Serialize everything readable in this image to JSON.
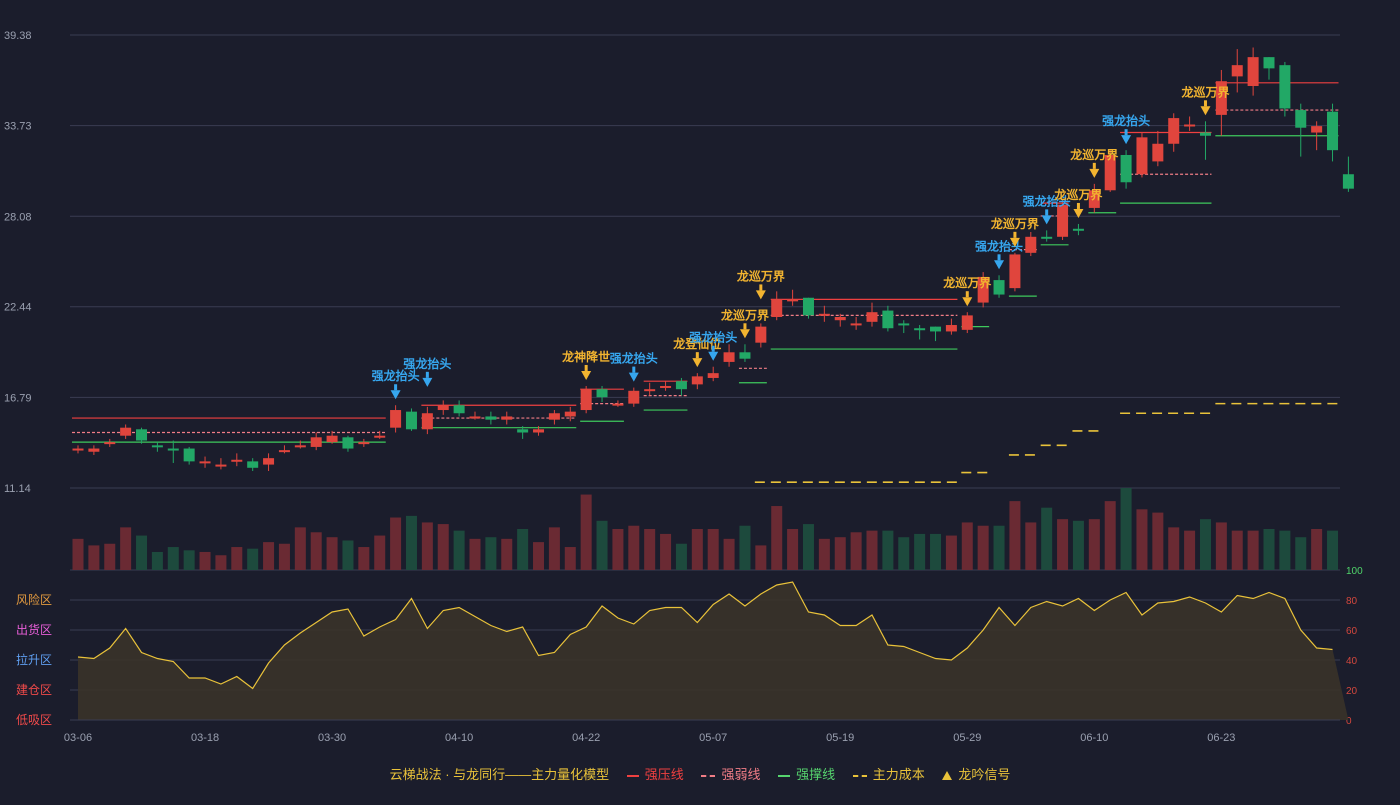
{
  "colors": {
    "background": "#1b1d2c",
    "up": "#e0453d",
    "down": "#22a866",
    "vol_up": "#6a2a33",
    "vol_down": "#1d4a3d",
    "strong_press": "#ef4040",
    "strong_weak": "#f07d86",
    "support": "#3ec95c",
    "cost": "#e9c23a",
    "signal_gold": "#f2b430",
    "signal_blue": "#36a6ee",
    "risk_line": "#e9c23a",
    "grid": "#3a3d52",
    "axis_text": "#9aa0b0"
  },
  "chart_data": {
    "type": "candlestick",
    "y_ticks": [
      "39.38",
      "33.73",
      "28.08",
      "22.44",
      "16.79",
      "11.14"
    ],
    "ylim": [
      11.14,
      39.38
    ],
    "x_ticks": [
      {
        "i": 0,
        "label": "03-06"
      },
      {
        "i": 8,
        "label": "03-18"
      },
      {
        "i": 16,
        "label": "03-30"
      },
      {
        "i": 24,
        "label": "04-10"
      },
      {
        "i": 32,
        "label": "04-22"
      },
      {
        "i": 40,
        "label": "05-07"
      },
      {
        "i": 48,
        "label": "05-19"
      },
      {
        "i": 56,
        "label": "05-29"
      },
      {
        "i": 64,
        "label": "06-10"
      },
      {
        "i": 72,
        "label": "06-23"
      }
    ],
    "candles": [
      [
        13.5,
        13.6,
        13.8,
        13.3
      ],
      [
        13.4,
        13.6,
        13.8,
        13.2
      ],
      [
        13.9,
        14.0,
        14.2,
        13.7
      ],
      [
        14.4,
        14.9,
        15.1,
        14.2
      ],
      [
        14.8,
        14.1,
        14.9,
        13.9
      ],
      [
        13.8,
        13.7,
        14.0,
        13.4
      ],
      [
        13.6,
        13.5,
        14.1,
        12.7
      ],
      [
        13.6,
        12.8,
        13.7,
        12.6
      ],
      [
        12.7,
        12.8,
        13.1,
        12.4
      ],
      [
        12.5,
        12.6,
        13.0,
        12.3
      ],
      [
        12.8,
        12.9,
        13.3,
        12.5
      ],
      [
        12.8,
        12.4,
        13.0,
        12.2
      ],
      [
        12.6,
        13.0,
        13.3,
        12.2
      ],
      [
        13.4,
        13.5,
        13.8,
        13.3
      ],
      [
        13.7,
        13.8,
        14.1,
        13.6
      ],
      [
        13.7,
        14.3,
        14.6,
        13.5
      ],
      [
        14.0,
        14.4,
        14.7,
        13.9
      ],
      [
        14.3,
        13.6,
        14.4,
        13.4
      ],
      [
        13.9,
        14.0,
        14.2,
        13.7
      ],
      [
        14.3,
        14.4,
        14.7,
        14.2
      ],
      [
        14.9,
        16.0,
        16.3,
        14.6
      ],
      [
        15.9,
        14.8,
        16.1,
        14.7
      ],
      [
        14.8,
        15.8,
        16.2,
        14.5
      ],
      [
        16.0,
        16.3,
        16.6,
        15.7
      ],
      [
        16.3,
        15.8,
        16.6,
        15.6
      ],
      [
        15.6,
        15.6,
        15.9,
        15.4
      ],
      [
        15.6,
        15.4,
        15.9,
        15.1
      ],
      [
        15.4,
        15.6,
        15.9,
        15.1
      ],
      [
        14.8,
        14.6,
        15.0,
        14.2
      ],
      [
        14.6,
        14.8,
        15.0,
        14.4
      ],
      [
        15.4,
        15.8,
        16.0,
        15.1
      ],
      [
        15.6,
        15.9,
        16.2,
        15.3
      ],
      [
        16.0,
        17.3,
        17.5,
        15.8
      ],
      [
        17.3,
        16.8,
        17.5,
        16.5
      ],
      [
        16.3,
        16.4,
        16.6,
        16.2
      ],
      [
        16.4,
        17.2,
        17.4,
        16.2
      ],
      [
        17.2,
        17.3,
        17.7,
        16.9
      ],
      [
        17.4,
        17.5,
        17.8,
        17.2
      ],
      [
        17.8,
        17.3,
        18.0,
        16.9
      ],
      [
        17.6,
        18.1,
        18.3,
        17.3
      ],
      [
        18.0,
        18.3,
        18.7,
        17.8
      ],
      [
        19.0,
        19.6,
        20.1,
        18.7
      ],
      [
        19.6,
        19.2,
        20.1,
        19.0
      ],
      [
        20.2,
        21.2,
        21.4,
        19.9
      ],
      [
        21.8,
        22.9,
        23.4,
        21.6
      ],
      [
        22.8,
        22.9,
        23.5,
        22.5
      ],
      [
        23.0,
        21.9,
        23.0,
        21.7
      ],
      [
        21.9,
        22.0,
        22.5,
        21.5
      ],
      [
        21.6,
        21.8,
        22.0,
        21.2
      ],
      [
        21.3,
        21.4,
        21.8,
        21.0
      ],
      [
        21.5,
        22.1,
        22.7,
        21.2
      ],
      [
        22.2,
        21.1,
        22.5,
        20.9
      ],
      [
        21.4,
        21.3,
        21.6,
        20.8
      ],
      [
        21.1,
        21.0,
        21.3,
        20.4
      ],
      [
        21.2,
        20.9,
        21.2,
        20.3
      ],
      [
        20.9,
        21.3,
        21.7,
        20.7
      ],
      [
        21.0,
        21.9,
        22.1,
        20.8
      ],
      [
        22.7,
        24.3,
        24.6,
        22.4
      ],
      [
        24.1,
        23.2,
        24.4,
        23.0
      ],
      [
        23.6,
        25.7,
        25.8,
        23.4
      ],
      [
        25.8,
        26.8,
        27.1,
        25.6
      ],
      [
        26.8,
        26.7,
        27.2,
        26.5
      ],
      [
        26.8,
        28.8,
        29.0,
        26.6
      ],
      [
        27.3,
        27.2,
        27.6,
        26.9
      ],
      [
        28.6,
        29.7,
        30.1,
        28.3
      ],
      [
        29.7,
        31.9,
        32.2,
        29.6
      ],
      [
        31.9,
        30.2,
        32.2,
        29.8
      ],
      [
        30.7,
        33.0,
        33.3,
        30.5
      ],
      [
        31.5,
        32.6,
        33.4,
        31.2
      ],
      [
        32.6,
        34.2,
        34.5,
        32.1
      ],
      [
        33.7,
        33.8,
        34.3,
        33.4
      ],
      [
        33.3,
        33.1,
        34.0,
        31.6
      ],
      [
        34.4,
        36.5,
        37.2,
        33.1
      ],
      [
        36.8,
        37.5,
        38.5,
        35.8
      ],
      [
        36.2,
        38.0,
        38.6,
        35.6
      ],
      [
        38.0,
        37.3,
        38.0,
        36.6
      ],
      [
        37.5,
        34.8,
        37.7,
        34.3
      ],
      [
        34.7,
        33.6,
        35.1,
        31.8
      ],
      [
        33.3,
        33.7,
        34.0,
        32.2
      ],
      [
        34.6,
        32.2,
        35.1,
        31.5
      ],
      [
        30.7,
        29.8,
        31.8,
        29.6
      ]
    ],
    "volumes": [
      0.38,
      0.3,
      0.32,
      0.52,
      0.42,
      0.22,
      0.28,
      0.24,
      0.22,
      0.18,
      0.28,
      0.26,
      0.34,
      0.32,
      0.52,
      0.46,
      0.4,
      0.36,
      0.28,
      0.42,
      0.64,
      0.66,
      0.58,
      0.56,
      0.48,
      0.38,
      0.4,
      0.38,
      0.5,
      0.34,
      0.52,
      0.28,
      0.92,
      0.6,
      0.5,
      0.54,
      0.5,
      0.44,
      0.32,
      0.5,
      0.5,
      0.38,
      0.54,
      0.3,
      0.78,
      0.5,
      0.56,
      0.38,
      0.4,
      0.46,
      0.48,
      0.48,
      0.4,
      0.44,
      0.44,
      0.42,
      0.58,
      0.54,
      0.54,
      0.84,
      0.58,
      0.76,
      0.62,
      0.6,
      0.62,
      0.84,
      1.1,
      0.74,
      0.7,
      0.52,
      0.48,
      0.62,
      0.58,
      0.48,
      0.48,
      0.5,
      0.48,
      0.4,
      0.5,
      0.48
    ],
    "risk_index": [
      42,
      41,
      48,
      61,
      45,
      41,
      39,
      28,
      28,
      24,
      29,
      21,
      38,
      50,
      58,
      65,
      72,
      74,
      56,
      62,
      67,
      81,
      61,
      73,
      75,
      69,
      63,
      59,
      62,
      43,
      45,
      57,
      62,
      76,
      68,
      64,
      73,
      75,
      75,
      65,
      77,
      84,
      76,
      84,
      90,
      92,
      72,
      70,
      63,
      63,
      70,
      50,
      49,
      45,
      41,
      40,
      48,
      60,
      75,
      63,
      75,
      79,
      76,
      81,
      73,
      80,
      85,
      70,
      78,
      79,
      82,
      78,
      72,
      83,
      81,
      85,
      81,
      60,
      48,
      47
    ],
    "risk_axis": [
      "100",
      "80",
      "60",
      "40",
      "20",
      "0"
    ],
    "zones": [
      "风险区",
      "出货区",
      "拉升区",
      "建仓区",
      "低吸区"
    ],
    "zone_colors": [
      "#e39a3f",
      "#e85ed8",
      "#5f9ef0",
      "#f04a4a",
      "#f04a4a"
    ],
    "levels": [
      {
        "kind": "press",
        "from": 0,
        "to": 19,
        "y": 15.5
      },
      {
        "kind": "weak",
        "from": 0,
        "to": 19,
        "y": 14.6
      },
      {
        "kind": "support",
        "from": 0,
        "to": 19,
        "y": 14.0
      },
      {
        "kind": "press",
        "from": 22,
        "to": 31,
        "y": 16.3
      },
      {
        "kind": "weak",
        "from": 22,
        "to": 31,
        "y": 15.5
      },
      {
        "kind": "support",
        "from": 22,
        "to": 31,
        "y": 14.9
      },
      {
        "kind": "press",
        "from": 32,
        "to": 34,
        "y": 17.3
      },
      {
        "kind": "weak",
        "from": 32,
        "to": 34,
        "y": 16.4
      },
      {
        "kind": "support",
        "from": 32,
        "to": 34,
        "y": 15.3
      },
      {
        "kind": "press",
        "from": 36,
        "to": 38,
        "y": 17.8
      },
      {
        "kind": "weak",
        "from": 36,
        "to": 38,
        "y": 16.9
      },
      {
        "kind": "support",
        "from": 36,
        "to": 38,
        "y": 16.0
      },
      {
        "kind": "weak",
        "from": 42,
        "to": 43,
        "y": 18.6
      },
      {
        "kind": "support",
        "from": 42,
        "to": 43,
        "y": 17.7
      },
      {
        "kind": "press",
        "from": 44,
        "to": 55,
        "y": 22.9
      },
      {
        "kind": "weak",
        "from": 44,
        "to": 55,
        "y": 21.9
      },
      {
        "kind": "support",
        "from": 44,
        "to": 55,
        "y": 19.8
      },
      {
        "kind": "support",
        "from": 56,
        "to": 57,
        "y": 21.2
      },
      {
        "kind": "support",
        "from": 59,
        "to": 60,
        "y": 23.1
      },
      {
        "kind": "weak",
        "from": 59,
        "to": 60,
        "y": 26.0
      },
      {
        "kind": "press",
        "from": 61,
        "to": 62,
        "y": 28.9
      },
      {
        "kind": "weak",
        "from": 61,
        "to": 62,
        "y": 28.1
      },
      {
        "kind": "support",
        "from": 61,
        "to": 62,
        "y": 26.3
      },
      {
        "kind": "support",
        "from": 64,
        "to": 65,
        "y": 28.3
      },
      {
        "kind": "press",
        "from": 66,
        "to": 71,
        "y": 33.3
      },
      {
        "kind": "weak",
        "from": 66,
        "to": 71,
        "y": 30.7
      },
      {
        "kind": "support",
        "from": 66,
        "to": 71,
        "y": 28.9
      },
      {
        "kind": "press",
        "from": 72,
        "to": 79,
        "y": 36.4
      },
      {
        "kind": "weak",
        "from": 72,
        "to": 79,
        "y": 34.7
      },
      {
        "kind": "support",
        "from": 72,
        "to": 79,
        "y": 33.1
      }
    ],
    "cost_segments": [
      {
        "from": 43,
        "to": 55,
        "y": 11.5
      },
      {
        "from": 56,
        "to": 57,
        "y": 12.1
      },
      {
        "from": 59,
        "to": 60,
        "y": 13.2
      },
      {
        "from": 61,
        "to": 62,
        "y": 13.8
      },
      {
        "from": 63,
        "to": 64,
        "y": 14.7
      },
      {
        "from": 66,
        "to": 71,
        "y": 15.8
      },
      {
        "from": 72,
        "to": 79,
        "y": 16.4
      }
    ],
    "signals": [
      {
        "i": 20,
        "label": "强龙抬头",
        "color": "blue",
        "dy": 0
      },
      {
        "i": 22,
        "label": "强龙抬头",
        "color": "blue",
        "dy": 14
      },
      {
        "i": 32,
        "label": "龙神降世",
        "color": "gold",
        "dy": 0
      },
      {
        "i": 35,
        "label": "强龙抬头",
        "color": "blue",
        "dy": 0
      },
      {
        "i": 39,
        "label": "龙登仙位",
        "color": "gold",
        "dy": 0
      },
      {
        "i": 40,
        "label": "强龙抬头",
        "color": "blue",
        "dy": 0
      },
      {
        "i": 42,
        "label": "龙巡万界",
        "color": "gold",
        "dy": 0
      },
      {
        "i": 43,
        "label": "龙巡万界",
        "color": "gold",
        "dy": 18
      },
      {
        "i": 56,
        "label": "龙巡万界",
        "color": "gold",
        "dy": 0
      },
      {
        "i": 58,
        "label": "强龙抬头",
        "color": "blue",
        "dy": 0
      },
      {
        "i": 59,
        "label": "龙巡万界",
        "color": "gold",
        "dy": 0
      },
      {
        "i": 61,
        "label": "强龙抬头",
        "color": "blue",
        "dy": 0
      },
      {
        "i": 63,
        "label": "龙巡万界",
        "color": "gold",
        "dy": 0
      },
      {
        "i": 64,
        "label": "龙巡万界",
        "color": "gold",
        "dy": 0
      },
      {
        "i": 66,
        "label": "强龙抬头",
        "color": "blue",
        "dy": 0
      },
      {
        "i": 71,
        "label": "龙巡万界",
        "color": "gold",
        "dy": 0
      }
    ]
  },
  "legend": {
    "title": "云梯战法 · 与龙同行——主力量化模型",
    "strong_press": "强压线",
    "strong_weak": "强弱线",
    "support": "强撑线",
    "main_cost": "主力成本",
    "signal": "龙吟信号"
  }
}
